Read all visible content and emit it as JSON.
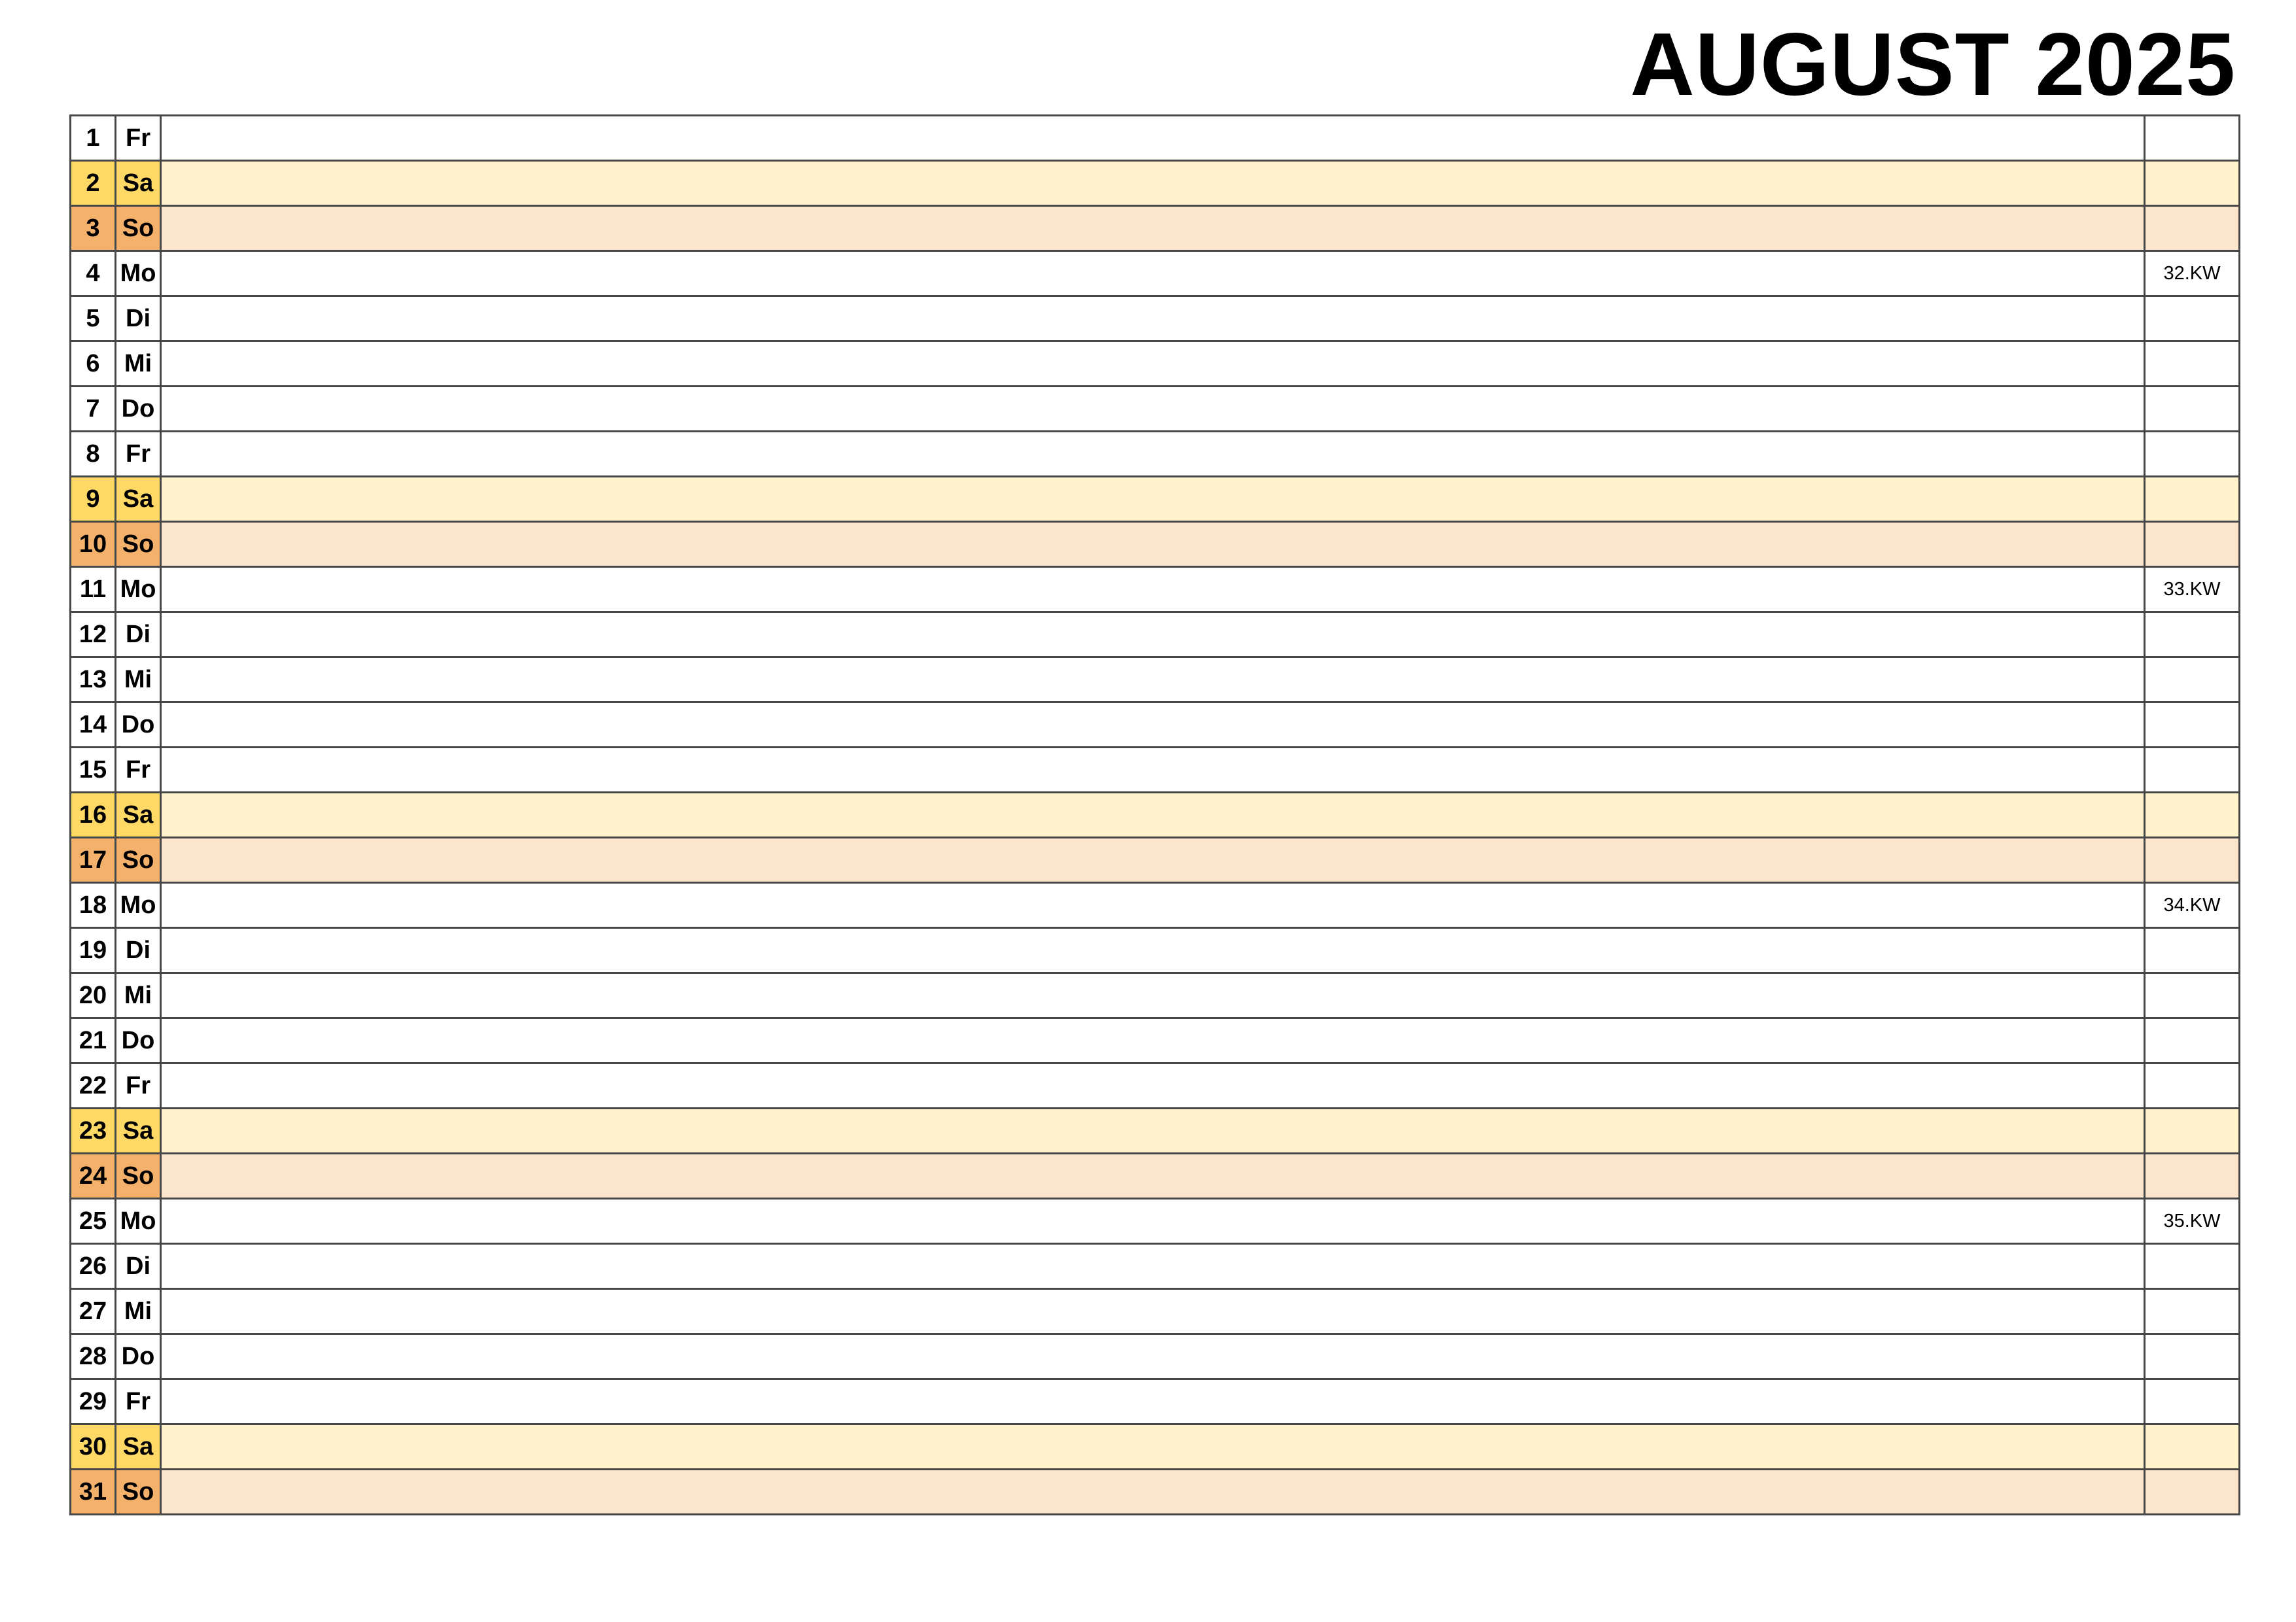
{
  "title": "AUGUST 2025",
  "colors": {
    "saturday_label": "#FED966",
    "saturday_row": "#FFF2CC",
    "sunday_label": "#F4B16C",
    "sunday_row": "#FCE5CD",
    "border": "#474747"
  },
  "days": [
    {
      "day": "1",
      "weekday": "Fr",
      "type": "weekday",
      "kw": ""
    },
    {
      "day": "2",
      "weekday": "Sa",
      "type": "sat",
      "kw": ""
    },
    {
      "day": "3",
      "weekday": "So",
      "type": "sun",
      "kw": ""
    },
    {
      "day": "4",
      "weekday": "Mo",
      "type": "weekday",
      "kw": "32.KW"
    },
    {
      "day": "5",
      "weekday": "Di",
      "type": "weekday",
      "kw": ""
    },
    {
      "day": "6",
      "weekday": "Mi",
      "type": "weekday",
      "kw": ""
    },
    {
      "day": "7",
      "weekday": "Do",
      "type": "weekday",
      "kw": ""
    },
    {
      "day": "8",
      "weekday": "Fr",
      "type": "weekday",
      "kw": ""
    },
    {
      "day": "9",
      "weekday": "Sa",
      "type": "sat",
      "kw": ""
    },
    {
      "day": "10",
      "weekday": "So",
      "type": "sun",
      "kw": ""
    },
    {
      "day": "11",
      "weekday": "Mo",
      "type": "weekday",
      "kw": "33.KW"
    },
    {
      "day": "12",
      "weekday": "Di",
      "type": "weekday",
      "kw": ""
    },
    {
      "day": "13",
      "weekday": "Mi",
      "type": "weekday",
      "kw": ""
    },
    {
      "day": "14",
      "weekday": "Do",
      "type": "weekday",
      "kw": ""
    },
    {
      "day": "15",
      "weekday": "Fr",
      "type": "weekday",
      "kw": ""
    },
    {
      "day": "16",
      "weekday": "Sa",
      "type": "sat",
      "kw": ""
    },
    {
      "day": "17",
      "weekday": "So",
      "type": "sun",
      "kw": ""
    },
    {
      "day": "18",
      "weekday": "Mo",
      "type": "weekday",
      "kw": "34.KW"
    },
    {
      "day": "19",
      "weekday": "Di",
      "type": "weekday",
      "kw": ""
    },
    {
      "day": "20",
      "weekday": "Mi",
      "type": "weekday",
      "kw": ""
    },
    {
      "day": "21",
      "weekday": "Do",
      "type": "weekday",
      "kw": ""
    },
    {
      "day": "22",
      "weekday": "Fr",
      "type": "weekday",
      "kw": ""
    },
    {
      "day": "23",
      "weekday": "Sa",
      "type": "sat",
      "kw": ""
    },
    {
      "day": "24",
      "weekday": "So",
      "type": "sun",
      "kw": ""
    },
    {
      "day": "25",
      "weekday": "Mo",
      "type": "weekday",
      "kw": "35.KW"
    },
    {
      "day": "26",
      "weekday": "Di",
      "type": "weekday",
      "kw": ""
    },
    {
      "day": "27",
      "weekday": "Mi",
      "type": "weekday",
      "kw": ""
    },
    {
      "day": "28",
      "weekday": "Do",
      "type": "weekday",
      "kw": ""
    },
    {
      "day": "29",
      "weekday": "Fr",
      "type": "weekday",
      "kw": ""
    },
    {
      "day": "30",
      "weekday": "Sa",
      "type": "sat",
      "kw": ""
    },
    {
      "day": "31",
      "weekday": "So",
      "type": "sun",
      "kw": ""
    }
  ]
}
